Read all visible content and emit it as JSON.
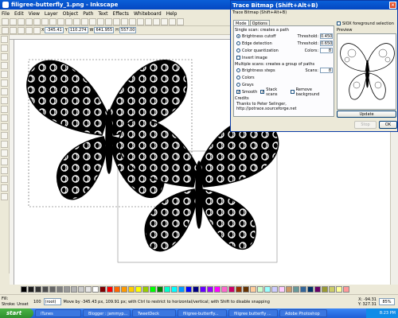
{
  "window": {
    "title": "filigree-butterfly_1.png - Inkscape"
  },
  "menu": [
    "File",
    "Edit",
    "View",
    "Layer",
    "Object",
    "Path",
    "Text",
    "Effects",
    "Whiteboard",
    "Help"
  ],
  "controls": {
    "x_label": "X",
    "x_value": "-345.41",
    "y_label": "Y",
    "y_value": "110.274",
    "w_label": "W",
    "w_value": "641.955",
    "h_label": "H",
    "h_value": "557.00"
  },
  "dialog": {
    "title": "Trace Bitmap (Shift+Alt+B)",
    "subtitle": "Trace Bitmap (Shift+Alt+B)",
    "tab_mode": "Mode",
    "tab_options": "Options",
    "single_scan_label": "Single scan: creates a path",
    "brightness_cutoff": "Brightness cutoff",
    "threshold_label": "Threshold:",
    "brightness_threshold": "0.450",
    "edge_detection": "Edge detection",
    "edge_threshold": "0.650",
    "color_quantization": "Color quantization",
    "colors_label": "Colors:",
    "colors_value": "8",
    "invert_image": "Invert image",
    "multiple_scans_label": "Multiple scans: creates a group of paths",
    "brightness_steps": "Brightness steps",
    "scans_label": "Scans:",
    "scans_value": "8",
    "colors": "Colors",
    "grays": "Grays",
    "smooth": "Smooth",
    "stack_scans": "Stack scans",
    "remove_background": "Remove background",
    "credits_label": "Credits",
    "credits_text": "Thanks to Peter Selinger, http://potrace.sourceforge.net",
    "sioux_label": "SIOX foreground selection",
    "preview_label": "Preview",
    "update_button": "Update",
    "stop_button": "Stop",
    "ok_button": "OK"
  },
  "status": {
    "fill_label": "Fill:",
    "stroke_label": "Stroke:",
    "stroke_value": "Unset",
    "opacity": "100",
    "layer": "(root)",
    "message": "Move by -345.43 px, 109.91 px; with Ctrl to restrict to horizontal/vertical; with Shift to disable snapping",
    "x_coord": "X: -94.31",
    "y_coord": "Y: 327.31",
    "zoom": "85%"
  },
  "palette_colors": [
    "#000000",
    "#1a1a1a",
    "#333333",
    "#4d4d4d",
    "#666666",
    "#808080",
    "#999999",
    "#b3b3b3",
    "#cccccc",
    "#e6e6e6",
    "#ffffff",
    "#800000",
    "#ff0000",
    "#ff6600",
    "#ff9900",
    "#ffcc00",
    "#ffff00",
    "#99cc00",
    "#00ff00",
    "#008000",
    "#00ffcc",
    "#00ffff",
    "#0099ff",
    "#0000ff",
    "#000080",
    "#6600ff",
    "#9900ff",
    "#ff00ff",
    "#ff66cc",
    "#cc0066",
    "#993300",
    "#663300",
    "#ffcc99",
    "#ccffcc",
    "#99ffff",
    "#ccccff",
    "#ffccff",
    "#cc9966",
    "#669999",
    "#336699",
    "#003366",
    "#660066",
    "#999933",
    "#cccc66",
    "#ffff99",
    "#ff9999"
  ],
  "taskbar": {
    "start": "start",
    "tasks": [
      "iTunes",
      "Blogger : jammyp...",
      "TweetDeck",
      "filigree-butterfly...",
      "filigree butterfly ...",
      "Adobe Photoshop"
    ],
    "clock": "8:23 PM"
  }
}
